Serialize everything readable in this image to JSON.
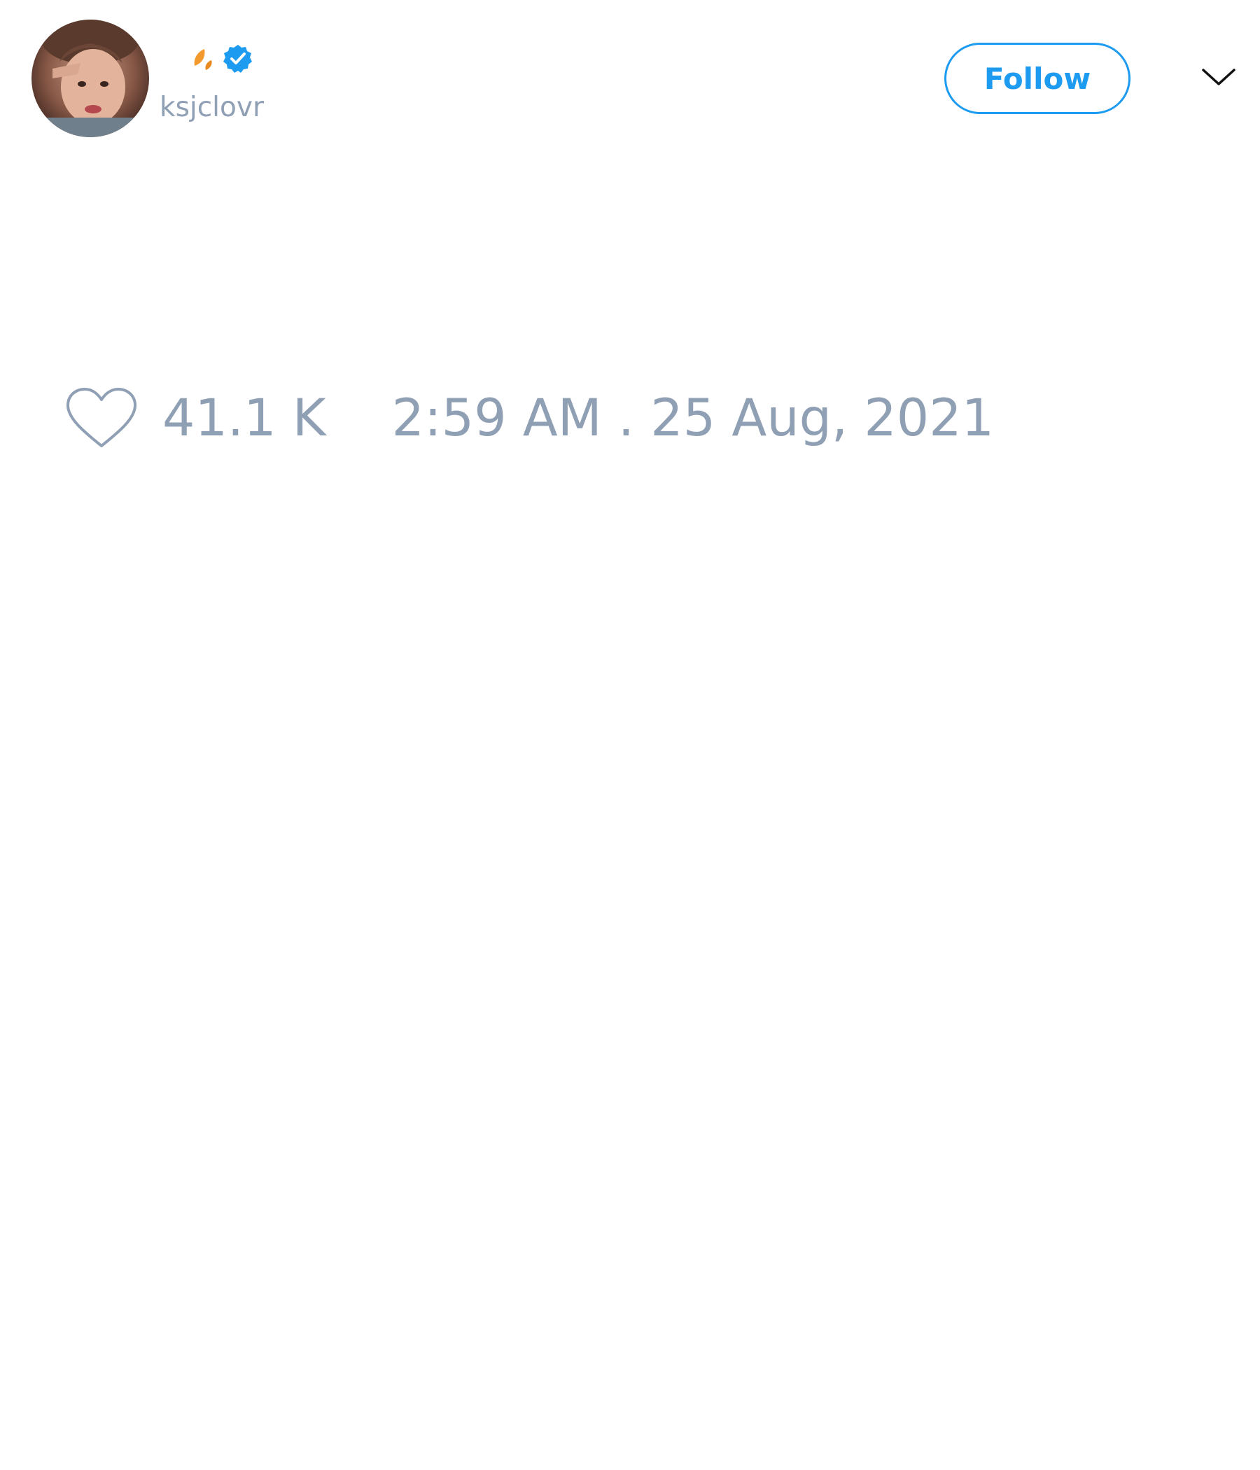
{
  "user": {
    "handle": "ksjclovr",
    "verified": true,
    "display_name_icons": [
      "leaf-icon",
      "verified-icon"
    ]
  },
  "header": {
    "follow_label": "Follow",
    "menu_icon": "chevron-down-icon"
  },
  "footer": {
    "like_icon": "heart-icon",
    "like_count": "41.1 K",
    "timestamp": "2:59 AM . 25 Aug, 2021"
  },
  "colors": {
    "accent": "#1d9bf0",
    "muted_text": "#8f9fb4",
    "leaf": "#f29a2e",
    "background": "#ffffff"
  }
}
